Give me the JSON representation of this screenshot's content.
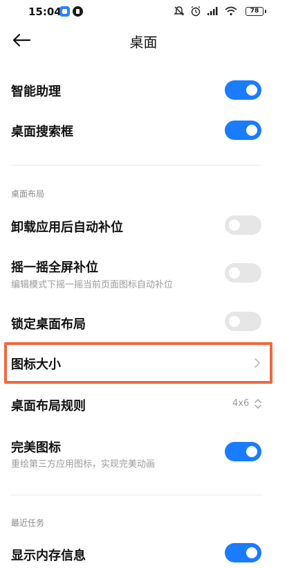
{
  "status_bar": {
    "time": "15:04",
    "battery": "78"
  },
  "header": {
    "title": "桌面"
  },
  "rows": {
    "smart_assistant": {
      "label": "智能助理",
      "state": "on"
    },
    "desktop_search": {
      "label": "桌面搜索框",
      "state": "on"
    },
    "auto_fill": {
      "label": "卸载应用后自动补位",
      "state": "off"
    },
    "shake_fill": {
      "label": "摇一摇全屏补位",
      "subtitle": "编辑模式下摇一摇当前页面图标自动补位",
      "state": "off"
    },
    "lock_layout": {
      "label": "锁定桌面布局",
      "state": "off"
    },
    "icon_size": {
      "label": "图标大小"
    },
    "layout_rule": {
      "label": "桌面布局规则",
      "value": "4x6"
    },
    "perfect_icons": {
      "label": "完美图标",
      "subtitle": "重绘第三方应用图标，实现完美动画",
      "state": "on"
    },
    "memory_info": {
      "label": "显示内存信息",
      "state": "on"
    }
  },
  "sections": {
    "layout": "桌面布局",
    "recent": "最近任务"
  },
  "colors": {
    "switch_on": "#1a7cff",
    "switch_off": "#e6e6e6",
    "highlight": "#f0683c"
  }
}
